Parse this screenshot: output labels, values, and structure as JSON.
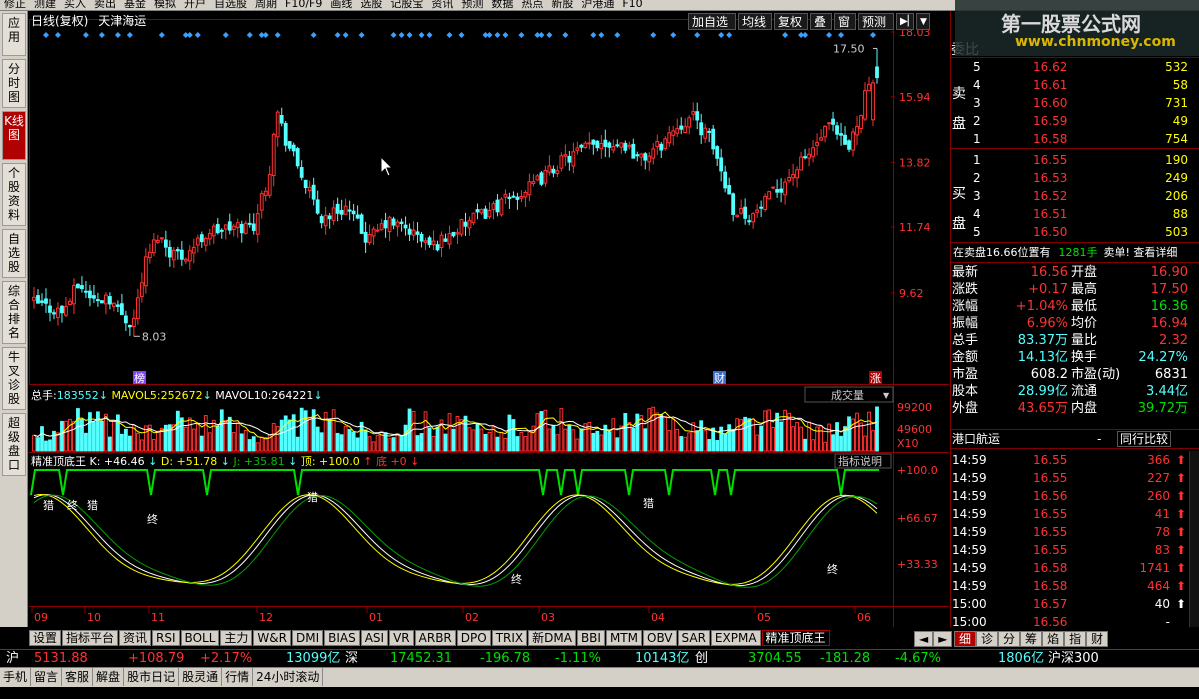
{
  "topbar": {
    "items": [
      "修正",
      "测建",
      "买入",
      "卖出",
      "基金",
      "模拟",
      "开户",
      "自选股",
      "周期",
      "F10/F9",
      "画线",
      "选股",
      "记股宝",
      "资讯",
      "预测",
      "数据",
      "热点",
      "新股",
      "沪港通",
      "F10"
    ]
  },
  "leftnav": {
    "items": [
      "应用",
      "分时图",
      "K线图",
      "个股资料",
      "自选股",
      "综合排名",
      "牛叉诊股",
      "超级盘口"
    ]
  },
  "header": {
    "period": "日线(复权)",
    "stock": "天津海运",
    "buttons": [
      "加自选",
      "均线",
      "复权",
      "叠",
      "窗",
      "预测"
    ]
  },
  "kchart": {
    "price_ticks": [
      "18.03",
      "15.94",
      "13.82",
      "11.74",
      "9.62"
    ],
    "high_label": "17.50",
    "low_label": "8.03",
    "markers": [
      "榜",
      "财",
      "涨"
    ]
  },
  "volume": {
    "label_total": "总手:",
    "total": "183552",
    "mavol5_label": "MAVOL5:",
    "mavol5": "252672",
    "mavol10_label": "MAVOL10:",
    "mavol10": "264221",
    "dropdown": "成交量",
    "ticks": [
      "99200",
      "49600",
      "X10"
    ]
  },
  "indicator": {
    "name": "精准顶底王",
    "k": "K: +46.46",
    "d": "D: +51.78",
    "j": "J: +35.81",
    "top": "顶: +100.0",
    "bottom": "底 +0",
    "explain": "指标说明",
    "ticks": [
      "+100.0",
      "+66.67",
      "+33.33"
    ],
    "annot_buy": [
      "猎",
      "终",
      "猎",
      "猎",
      "猎"
    ],
    "annot_sell": [
      "终",
      "终",
      "终"
    ]
  },
  "months": [
    "09",
    "10",
    "11",
    "12",
    "01",
    "02",
    "03",
    "04",
    "05",
    "06"
  ],
  "bottom_tabs": [
    "设置",
    "指标平台",
    "资讯",
    "RSI",
    "BOLL",
    "主力",
    "W&R",
    "DMI",
    "BIAS",
    "ASI",
    "VR",
    "ARBR",
    "DPO",
    "TRIX",
    "新DMA",
    "BBI",
    "MTM",
    "OBV",
    "SAR",
    "EXPMA",
    "精准顶底王"
  ],
  "right_tabs": [
    "细",
    "诊",
    "分",
    "筹",
    "焰",
    "指",
    "财"
  ],
  "orderbook": {
    "wei_label": "委比",
    "sell_label": [
      "卖",
      "盘"
    ],
    "buy_label": [
      "买",
      "盘"
    ],
    "sells": [
      {
        "lvl": "5",
        "price": "16.62",
        "vol": "532"
      },
      {
        "lvl": "4",
        "price": "16.61",
        "vol": "58"
      },
      {
        "lvl": "3",
        "price": "16.60",
        "vol": "731"
      },
      {
        "lvl": "2",
        "price": "16.59",
        "vol": "49"
      },
      {
        "lvl": "1",
        "price": "16.58",
        "vol": "754"
      }
    ],
    "buys": [
      {
        "lvl": "1",
        "price": "16.55",
        "vol": "190"
      },
      {
        "lvl": "2",
        "price": "16.53",
        "vol": "249"
      },
      {
        "lvl": "3",
        "price": "16.52",
        "vol": "206"
      },
      {
        "lvl": "4",
        "price": "16.51",
        "vol": "88"
      },
      {
        "lvl": "5",
        "price": "16.50",
        "vol": "503"
      }
    ]
  },
  "infoline": {
    "text1": "在卖盘16.66位置有",
    "vol": "1281手",
    "text2": "卖单! 查看详细"
  },
  "stats": [
    {
      "l1": "最新",
      "v1": "16.56",
      "l2": "开盘",
      "v2": "16.90"
    },
    {
      "l1": "涨跌",
      "v1": "+0.17",
      "l2": "最高",
      "v2": "17.50"
    },
    {
      "l1": "涨幅",
      "v1": "+1.04%",
      "l2": "最低",
      "v2": "16.36"
    },
    {
      "l1": "振幅",
      "v1": "6.96%",
      "l2": "均价",
      "v2": "16.94"
    },
    {
      "l1": "总手",
      "v1": "83.37万",
      "l2": "量比",
      "v2": "2.32"
    },
    {
      "l1": "金额",
      "v1": "14.13亿",
      "l2": "换手",
      "v2": "24.27%"
    },
    {
      "l1": "市盈",
      "v1": "608.2",
      "l2": "市盈(动)",
      "v2": "6831"
    },
    {
      "l1": "股本",
      "v1": "28.99亿",
      "l2": "流通",
      "v2": "3.44亿"
    },
    {
      "l1": "外盘",
      "v1": "43.65万",
      "l2": "内盘",
      "v2": "39.72万"
    }
  ],
  "sector": {
    "name": "港口航运",
    "dash": "-",
    "compare": "同行比较"
  },
  "trades": [
    {
      "t": "14:59",
      "p": "16.55",
      "v": "366",
      "d": "up"
    },
    {
      "t": "14:59",
      "p": "16.55",
      "v": "227",
      "d": "up"
    },
    {
      "t": "14:59",
      "p": "16.56",
      "v": "260",
      "d": "up"
    },
    {
      "t": "14:59",
      "p": "16.55",
      "v": "41",
      "d": "up"
    },
    {
      "t": "14:59",
      "p": "16.55",
      "v": "78",
      "d": "up"
    },
    {
      "t": "14:59",
      "p": "16.55",
      "v": "83",
      "d": "up"
    },
    {
      "t": "14:59",
      "p": "16.58",
      "v": "1741",
      "d": "up"
    },
    {
      "t": "14:59",
      "p": "16.58",
      "v": "464",
      "d": "up"
    },
    {
      "t": "15:00",
      "p": "16.57",
      "v": "40",
      "d": "w"
    },
    {
      "t": "15:00",
      "p": "16.56",
      "v": "-",
      "d": ""
    }
  ],
  "indexbar": {
    "sh_label": "沪",
    "sh": "5131.88",
    "sh_chg": "+108.79",
    "sh_pct": "+2.17%",
    "sh_amt": "13099亿",
    "sz_label": "深",
    "sz": "17452.31",
    "sz_chg": "-196.78",
    "sz_pct": "-1.11%",
    "sz_amt": "10143亿",
    "cy_label": "创",
    "cy": "3704.55",
    "cy_chg": "-181.28",
    "cy_pct": "-4.67%",
    "hs_amt": "1806亿",
    "hs_label": "沪深300"
  },
  "statusbar": [
    "手机",
    "留言",
    "客服",
    "解盘",
    "股市日记",
    "股灵通",
    "行情",
    "24小时滚动"
  ],
  "watermark": {
    "line1": "第一股票公式网",
    "line2": "www.chnmoney.com"
  },
  "colors": {
    "up": "#ff3232",
    "down": "#54ffff",
    "grid": "#8b0000",
    "bg": "#000000",
    "yellow": "#ffff00"
  }
}
